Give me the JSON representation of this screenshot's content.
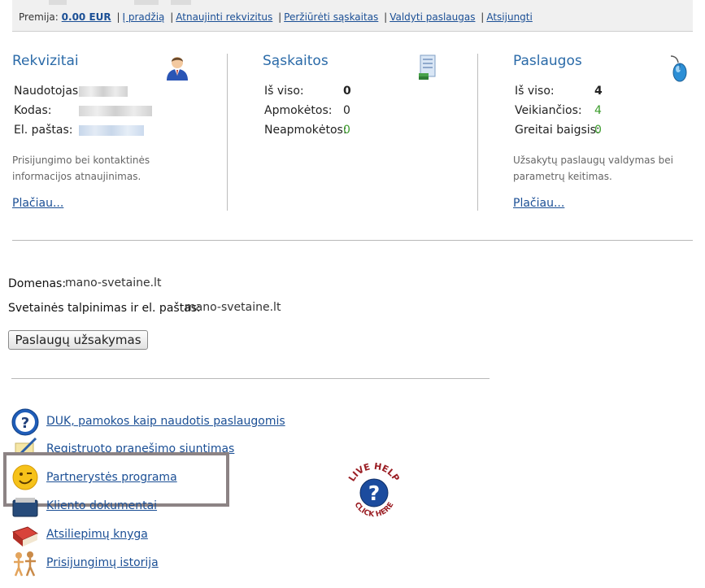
{
  "topbar": {
    "premium_label": "Premija:",
    "premium_value": "0.00 EUR",
    "links": [
      "Į pradžią",
      "Atnaujinti rekvizitus",
      "Peržiūrėti sąskaitas",
      "Valdyti paslaugas",
      "Atsijungti"
    ],
    "separator": "|"
  },
  "rekvizitai": {
    "title": "Rekvizitai",
    "user_label": "Naudotojas:",
    "code_label": "Kodas:",
    "email_label": "El. paštas:",
    "description": [
      "Prisijungimo bei kontaktinės",
      "informacijos atnaujinimas."
    ],
    "more": "Plačiau..."
  },
  "saskaitos": {
    "title": "Sąskaitos",
    "total_label": "Iš viso:",
    "total_value": "0",
    "paid_label": "Apmokėtos:",
    "paid_value": "0",
    "unpaid_label": "Neapmokėtos:",
    "unpaid_value": "0"
  },
  "paslaugos": {
    "title": "Paslaugos",
    "total_label": "Iš viso:",
    "total_value": "4",
    "active_label": "Veikiančios:",
    "active_value": "4",
    "expiring_label": "Greitai baigsis:",
    "expiring_value": "0",
    "description": [
      "Užsakytų paslaugų valdymas bei",
      "parametrų keitimas."
    ],
    "more": "Plačiau..."
  },
  "domain": {
    "domain_label": "Domenas:",
    "domain_value": "mano-svetaine.lt",
    "hosting_label": "Svetainės talpinimas ir el. paštas:",
    "hosting_value": "mano-svetaine.lt"
  },
  "order_button": "Paslaugų užsakymas",
  "links": [
    {
      "label": "DUK, pamokos kaip naudotis paslaugomis",
      "icon": "help-icon"
    },
    {
      "label": "Registruoto pranešimo siuntimas",
      "icon": "note-icon"
    },
    {
      "label": "Partnerystės programa",
      "icon": "smiley-icon"
    },
    {
      "label": "Kliento dokumentai",
      "icon": "document-icon"
    },
    {
      "label": "Atsiliepimų knyga",
      "icon": "book-icon"
    },
    {
      "label": "Prisijungimų istorija",
      "icon": "people-icon"
    }
  ],
  "live_help": {
    "top": "LIVE HELP",
    "bottom": "CLICK HERE",
    "symbol": "?"
  },
  "colors": {
    "title": "#2a6aa8",
    "link": "#1b4f95",
    "green": "#3a9b2a",
    "highlight_border": "#8c8384"
  }
}
